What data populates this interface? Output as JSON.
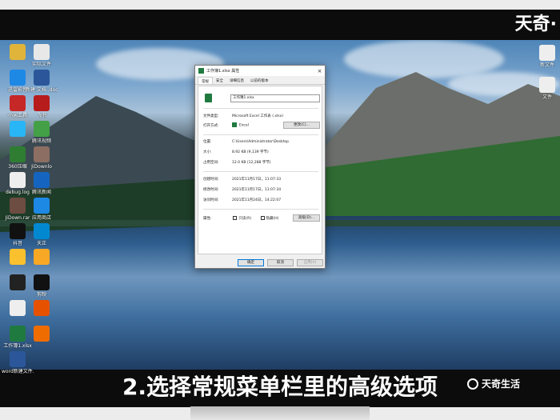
{
  "brand": {
    "top": "天奇·",
    "bottom": "天奇生活"
  },
  "caption": "2.选择常规菜单栏里的高级选项",
  "desktop_icons_left": [
    {
      "label": "",
      "icon": "folder-icon",
      "color": "#e0b43a"
    },
    {
      "label": "实际文件",
      "icon": "doc-icon",
      "color": "#e8e8e8"
    },
    {
      "label": "迅雷影音",
      "icon": "video-icon",
      "color": "#1e88e5"
    },
    {
      "label": "新建 文档 .docx",
      "icon": "word-icon",
      "color": "#2b579a"
    },
    {
      "label": "小宋工具",
      "icon": "tool-icon",
      "color": "#c62828"
    },
    {
      "label": "飞书",
      "icon": "acrobat-icon",
      "color": "#b71c1c"
    },
    {
      "label": "",
      "icon": "feishu-icon",
      "color": "#29b6f6"
    },
    {
      "label": "腾讯视频",
      "icon": "tv-icon",
      "color": "#43a047"
    },
    {
      "label": "360压缩",
      "icon": "zip-icon",
      "color": "#2e7d32"
    },
    {
      "label": "JiDownlo",
      "icon": "download-icon",
      "color": "#8d6e63"
    },
    {
      "label": "debug.log",
      "icon": "file-icon",
      "color": "#eeeeee"
    },
    {
      "label": "腾讯新闻",
      "icon": "news-icon",
      "color": "#1565c0"
    },
    {
      "label": "JiDown.rar",
      "icon": "rar-icon",
      "color": "#6d4c41"
    },
    {
      "label": "应用商店",
      "icon": "store-icon",
      "color": "#1e88e5"
    },
    {
      "label": "抖音",
      "icon": "tiktok-icon",
      "color": "#111111"
    },
    {
      "label": "天正",
      "icon": "app-icon",
      "color": "#0288d1"
    },
    {
      "label": "",
      "icon": "color-icon",
      "color": "#fbc02d"
    },
    {
      "label": "",
      "icon": "ring-icon",
      "color": "#f9a825"
    },
    {
      "label": "",
      "icon": "edit-icon",
      "color": "#222222"
    },
    {
      "label": "剪映",
      "icon": "capcut-icon",
      "color": "#111111"
    },
    {
      "label": "",
      "icon": "file-icon",
      "color": "#eeeeee"
    },
    {
      "label": "",
      "icon": "zip-icon",
      "color": "#e65100"
    },
    {
      "label": "工作簿1.xlsx",
      "icon": "excel-icon",
      "color": "#1f7a3f"
    },
    {
      "label": "",
      "icon": "tool-icon",
      "color": "#ef6c00"
    },
    {
      "label": "word新建文件.docx",
      "icon": "word-icon",
      "color": "#2b579a"
    }
  ],
  "desktop_icons_right": [
    {
      "label": "新文件",
      "icon": "file-icon",
      "color": "#eeeeee"
    },
    {
      "label": "文件",
      "icon": "file-icon",
      "color": "#eeeeee"
    }
  ],
  "dialog": {
    "title": "工作簿1.xlsx 属性",
    "close_glyph": "×",
    "tabs": [
      "常规",
      "安全",
      "详细信息",
      "以前的版本"
    ],
    "filename": "工作簿1.xlsx",
    "rows": [
      {
        "key": "文件类型:",
        "value": "Microsoft Excel 工作表 (.xlsx)"
      },
      {
        "key": "打开方式:",
        "value": "Excel"
      },
      {
        "key": "位置:",
        "value": "C:\\Users\\Administrator\\Desktop"
      },
      {
        "key": "大小:",
        "value": "8.92 KB (9,139 字节)"
      },
      {
        "key": "占用空间:",
        "value": "12.0 KB (12,288 字节)"
      },
      {
        "key": "创建时间:",
        "value": "2021年11月17日，11:07:33"
      },
      {
        "key": "修改时间:",
        "value": "2021年11月17日，11:07:34"
      },
      {
        "key": "访问时间:",
        "value": "2021年11月24日，14:22:07"
      }
    ],
    "change_button": "更改(C)...",
    "attributes_label": "属性:",
    "readonly_label": "只读(R)",
    "hidden_label": "隐藏(H)",
    "advanced_button": "高级(D)...",
    "ok_button": "确定",
    "cancel_button": "取消",
    "apply_button": "应用(A)"
  }
}
